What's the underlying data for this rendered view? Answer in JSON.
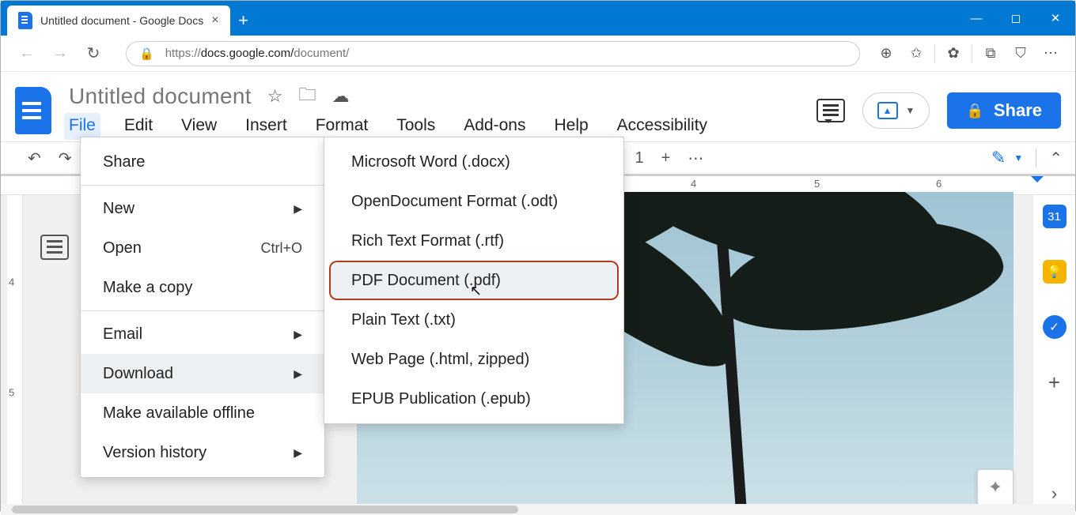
{
  "browser": {
    "tab_title": "Untitled document - Google Docs",
    "url_scheme": "https://",
    "url_host": "docs.google.com/",
    "url_path": "document/"
  },
  "docs": {
    "title": "Untitled document",
    "menus": [
      "File",
      "Edit",
      "View",
      "Insert",
      "Format",
      "Tools",
      "Add-ons",
      "Help",
      "Accessibility"
    ],
    "share_label": "Share",
    "toolbar_heading_num": "1"
  },
  "file_menu": {
    "share": "Share",
    "new": "New",
    "open": "Open",
    "open_shortcut": "Ctrl+O",
    "make_a_copy": "Make a copy",
    "email": "Email",
    "download": "Download",
    "make_available_offline": "Make available offline",
    "version_history": "Version history"
  },
  "download_submenu": {
    "docx": "Microsoft Word (.docx)",
    "odt": "OpenDocument Format (.odt)",
    "rtf": "Rich Text Format (.rtf)",
    "pdf": "PDF Document (.pdf)",
    "txt": "Plain Text (.txt)",
    "html": "Web Page (.html, zipped)",
    "epub": "EPUB Publication (.epub)"
  },
  "ruler": {
    "n4": "4",
    "n5": "5",
    "n6": "6",
    "v4": "4",
    "v5": "5"
  },
  "rail_calendar_day": "31"
}
